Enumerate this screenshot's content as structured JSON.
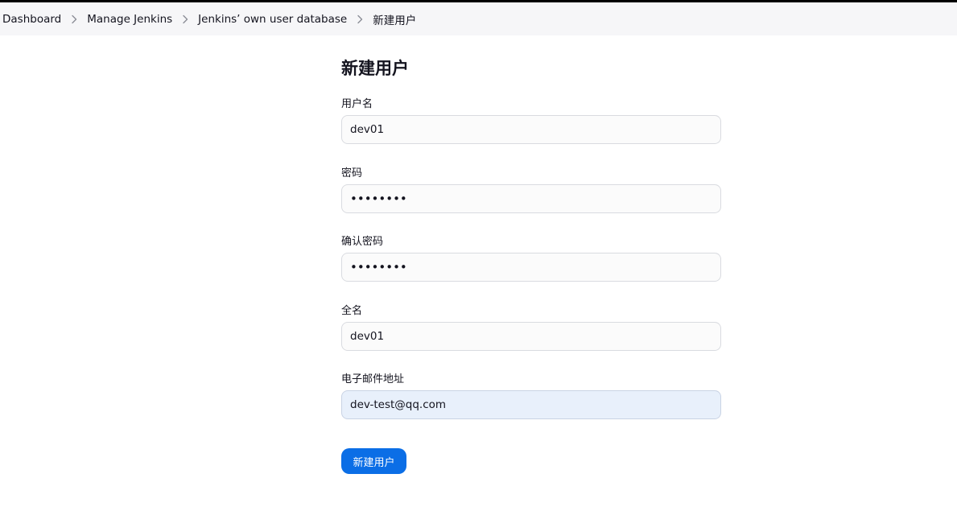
{
  "breadcrumb": {
    "items": [
      {
        "label": "Dashboard"
      },
      {
        "label": "Manage Jenkins"
      },
      {
        "label": "Jenkins’ own user database"
      },
      {
        "label": "新建用户"
      }
    ]
  },
  "page": {
    "title": "新建用户"
  },
  "form": {
    "username": {
      "label": "用户名",
      "value": "dev01"
    },
    "password": {
      "label": "密码",
      "value": "••••••••"
    },
    "confirm_password": {
      "label": "确认密码",
      "value": "••••••••"
    },
    "fullname": {
      "label": "全名",
      "value": "dev01"
    },
    "email": {
      "label": "电子邮件地址",
      "value": "dev-test@qq.com"
    },
    "submit_label": "新建用户"
  },
  "colors": {
    "breadcrumb_bg": "#f6f6f8",
    "accent": "#0b6ee6",
    "focused_input_bg": "#e8f0fb"
  },
  "icons": {
    "breadcrumb_separator": "chevron-right-icon"
  }
}
